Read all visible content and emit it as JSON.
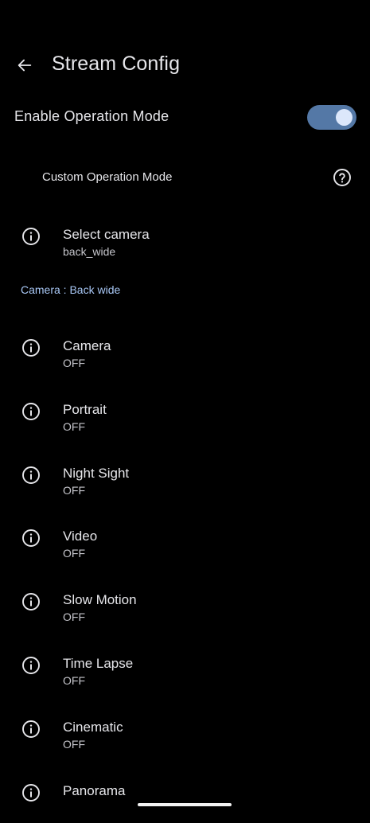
{
  "header": {
    "title": "Stream Config",
    "back_icon": "arrow-back-icon"
  },
  "master_switch": {
    "label": "Enable Operation Mode",
    "checked": true,
    "track_color": "#5478a6",
    "thumb_color": "#dce7fb"
  },
  "custom_mode": {
    "label": "Custom Operation Mode",
    "help_icon": "help-icon"
  },
  "select_camera": {
    "title": "Select camera",
    "value": "back_wide",
    "icon": "info-icon"
  },
  "section": {
    "title": "Camera : Back wide",
    "color": "#a8c7f5"
  },
  "modes": [
    {
      "title": "Camera",
      "value": "OFF",
      "icon": "info-icon"
    },
    {
      "title": "Portrait",
      "value": "OFF",
      "icon": "info-icon"
    },
    {
      "title": "Night Sight",
      "value": "OFF",
      "icon": "info-icon"
    },
    {
      "title": "Video",
      "value": "OFF",
      "icon": "info-icon"
    },
    {
      "title": "Slow Motion",
      "value": "OFF",
      "icon": "info-icon"
    },
    {
      "title": "Time Lapse",
      "value": "OFF",
      "icon": "info-icon"
    },
    {
      "title": "Cinematic",
      "value": "OFF",
      "icon": "info-icon"
    },
    {
      "title": "Panorama",
      "value": "",
      "icon": "info-icon"
    }
  ]
}
